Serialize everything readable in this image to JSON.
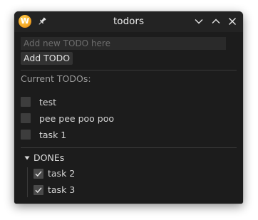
{
  "window": {
    "title": "todors",
    "app_icon_letter": "W"
  },
  "input": {
    "placeholder": "Add new TODO here",
    "value": ""
  },
  "add_button_label": "Add TODO",
  "todos_section_label": "Current TODOs:",
  "todos": [
    {
      "label": "test",
      "checked": false
    },
    {
      "label": "pee pee poo poo",
      "checked": false
    },
    {
      "label": "task 1",
      "checked": false
    }
  ],
  "dones": {
    "label": "DONEs",
    "expanded": true,
    "items": [
      {
        "label": "task 2",
        "checked": true
      },
      {
        "label": "task 3",
        "checked": true
      }
    ]
  },
  "colors": {
    "window_bg": "#1c1c1c",
    "titlebar_bg": "#232323",
    "checkbox_bg": "#3d3d3d",
    "text": "#d6d6d6"
  }
}
